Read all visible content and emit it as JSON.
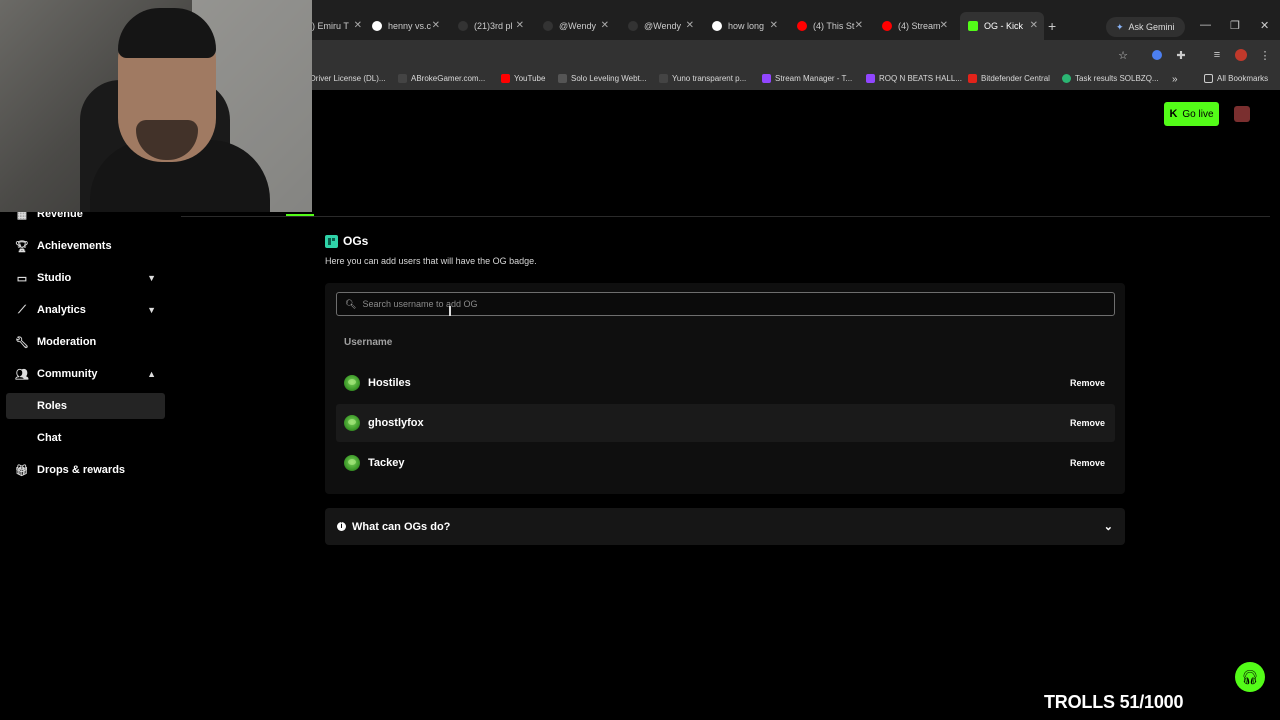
{
  "browser": {
    "tabs": [
      {
        "label": ") Emiru T",
        "favicon_color": "#222"
      },
      {
        "label": "henny vs.c",
        "favicon_color": "#fff"
      },
      {
        "label": "(21)3rd pl",
        "favicon_color": "#111"
      },
      {
        "label": "@Wendy",
        "favicon_color": "#111"
      },
      {
        "label": "@Wendy",
        "favicon_color": "#111"
      },
      {
        "label": "how long",
        "favicon_color": "#fff"
      },
      {
        "label": "(4) This St",
        "favicon_color": "#ff0000"
      },
      {
        "label": "(4) Stream",
        "favicon_color": "#ff0000"
      },
      {
        "label": "OG - Kick",
        "favicon_color": "#53fc18"
      }
    ],
    "new_tab": "+",
    "gemini_label": "Ask Gemini",
    "bookmarks": [
      {
        "label": "Driver License (DL)...",
        "color": "#555"
      },
      {
        "label": "ABrokeGamer.com...",
        "color": "#444"
      },
      {
        "label": "YouTube",
        "color": "#ff0000"
      },
      {
        "label": "Solo Leveling Webt...",
        "color": "#555"
      },
      {
        "label": "Yuno transparent p...",
        "color": "#444"
      },
      {
        "label": "Stream Manager - T...",
        "color": "#9146ff"
      },
      {
        "label": "ROQ N BEATS HALL...",
        "color": "#9146ff"
      },
      {
        "label": "Bitdefender Central",
        "color": "#e2231a"
      },
      {
        "label": "Task results SOLBZQ...",
        "color": "#2bb673"
      }
    ],
    "all_bookmarks": "All Bookmarks"
  },
  "header": {
    "go_live_label": "Go live"
  },
  "sidebar": {
    "items": [
      {
        "label": "Revenue",
        "icon": "revenue-icon"
      },
      {
        "label": "Achievements",
        "icon": "trophy-icon"
      },
      {
        "label": "Studio",
        "icon": "studio-icon"
      },
      {
        "label": "Analytics",
        "icon": "analytics-icon"
      },
      {
        "label": "Moderation",
        "icon": "wrench-icon"
      },
      {
        "label": "Community",
        "icon": "community-icon"
      },
      {
        "label": "Drops & rewards",
        "icon": "gift-icon"
      }
    ],
    "community_sub": [
      {
        "label": "Roles"
      },
      {
        "label": "Chat"
      }
    ]
  },
  "main": {
    "title": "OGs",
    "description": "Here you can add users that will have the OG badge.",
    "search_placeholder": "Search username to add OG",
    "column_header": "Username",
    "users": [
      {
        "name": "Hostiles",
        "action": "Remove"
      },
      {
        "name": "ghostlyfox",
        "action": "Remove"
      },
      {
        "name": "Tackey",
        "action": "Remove"
      }
    ],
    "faq_label": "What can OGs do?"
  },
  "overlay": {
    "trolls_text": "TROLLS 51/1000"
  },
  "colors": {
    "accent": "#53fc18",
    "badge": "#2fd3a8"
  }
}
